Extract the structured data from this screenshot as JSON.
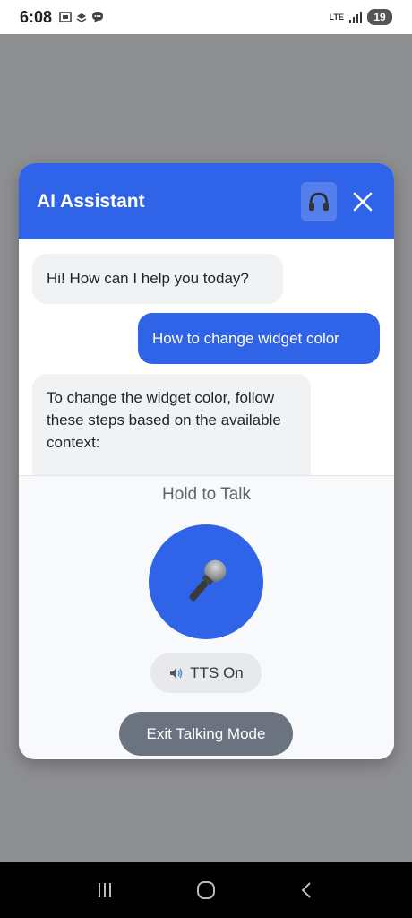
{
  "status_bar": {
    "time": "6:08",
    "network": "LTE",
    "battery": "19"
  },
  "widget": {
    "title": "AI Assistant",
    "accent_color": "#2f63e8",
    "header_icons": [
      "headphones-icon",
      "close-icon"
    ],
    "messages": [
      {
        "role": "bot",
        "text": "Hi! How can I help you today?"
      },
      {
        "role": "user",
        "text": "How to change widget color"
      },
      {
        "role": "bot",
        "text": "To change the widget color, follow these steps based on the available context:"
      }
    ],
    "voice": {
      "hold_label": "Hold to Talk",
      "mic_icon": "microphone-icon",
      "tts_label": "TTS On",
      "tts_icon": "speaker-icon",
      "exit_label": "Exit Talking Mode"
    }
  },
  "nav_bar": {
    "buttons": [
      "recents-icon",
      "home-icon",
      "back-icon"
    ]
  }
}
